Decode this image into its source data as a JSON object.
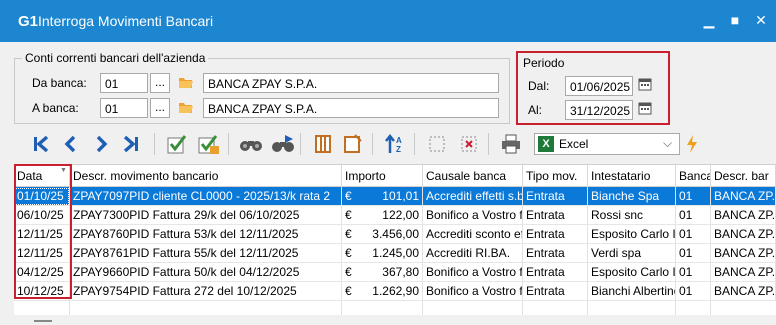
{
  "window": {
    "logo": "G1",
    "title": "Interroga Movimenti Bancari",
    "minimize": "▁",
    "maximize": "■",
    "close": "✕"
  },
  "accounts": {
    "group_label": "Conti correnti bancari dell'azienda",
    "from_label": "Da banca:",
    "from_code": "01",
    "from_name": "BANCA ZPAY S.P.A.",
    "to_label": "A banca:",
    "to_code": "01",
    "to_name": "BANCA ZPAY S.P.A.",
    "ellipsis": "..."
  },
  "period": {
    "group_label": "Periodo",
    "from_label": "Dal:",
    "from_date": "01/06/2025",
    "to_label": "Al:",
    "to_date": "31/12/2025"
  },
  "toolbar": {
    "export_value": "Excel",
    "export_icon": "X"
  },
  "grid": {
    "columns": [
      "Data",
      "Descr. movimento bancario",
      "Importo",
      "Causale banca",
      "Tipo mov.",
      "Intestatario",
      "Banca",
      "Descr. bar"
    ],
    "rows": [
      [
        "01/10/25",
        "ZPAY7097PID cliente CL0000 - 2025/13/k rata 2",
        "€",
        "101,01",
        "Accrediti effetti s.b.f.",
        "Entrata",
        "Bianche Spa",
        "01",
        "BANCA ZP."
      ],
      [
        "06/10/25",
        "ZPAY7300PID Fattura 29/k del 06/10/2025",
        "€",
        "122,00",
        "Bonifico a Vostro fav",
        "Entrata",
        "Rossi snc",
        "01",
        "BANCA ZP."
      ],
      [
        "12/11/25",
        "ZPAY8760PID Fattura 53/k del 12/11/2025",
        "€",
        "3.456,00",
        "Accrediti sconto effe",
        "Entrata",
        "Esposito Carlo Ind",
        "01",
        "BANCA ZP."
      ],
      [
        "12/11/25",
        "ZPAY8761PID Fattura 55/k del 12/11/2025",
        "€",
        "1.245,00",
        "Accrediti RI.BA.",
        "Entrata",
        "Verdi spa",
        "01",
        "BANCA ZP."
      ],
      [
        "04/12/25",
        "ZPAY9660PID Fattura 50/k del 04/12/2025",
        "€",
        "367,80",
        "Bonifico a Vostro fav",
        "Entrata",
        "Esposito Carlo Ind",
        "01",
        "BANCA ZP."
      ],
      [
        "10/12/25",
        "ZPAY9754PID Fattura 272 del 10/12/2025",
        "€",
        "1.262,90",
        "Bonifico a Vostro fav",
        "Entrata",
        "Bianchi Albertino",
        "01",
        "BANCA ZP."
      ]
    ]
  },
  "colors": {
    "titlebar": "#1c86d0",
    "selection": "#0b79d8",
    "highlight_border": "#c8202e",
    "toolbar_blue": "#1e5fb4",
    "toolbar_green": "#3a8f3a"
  }
}
